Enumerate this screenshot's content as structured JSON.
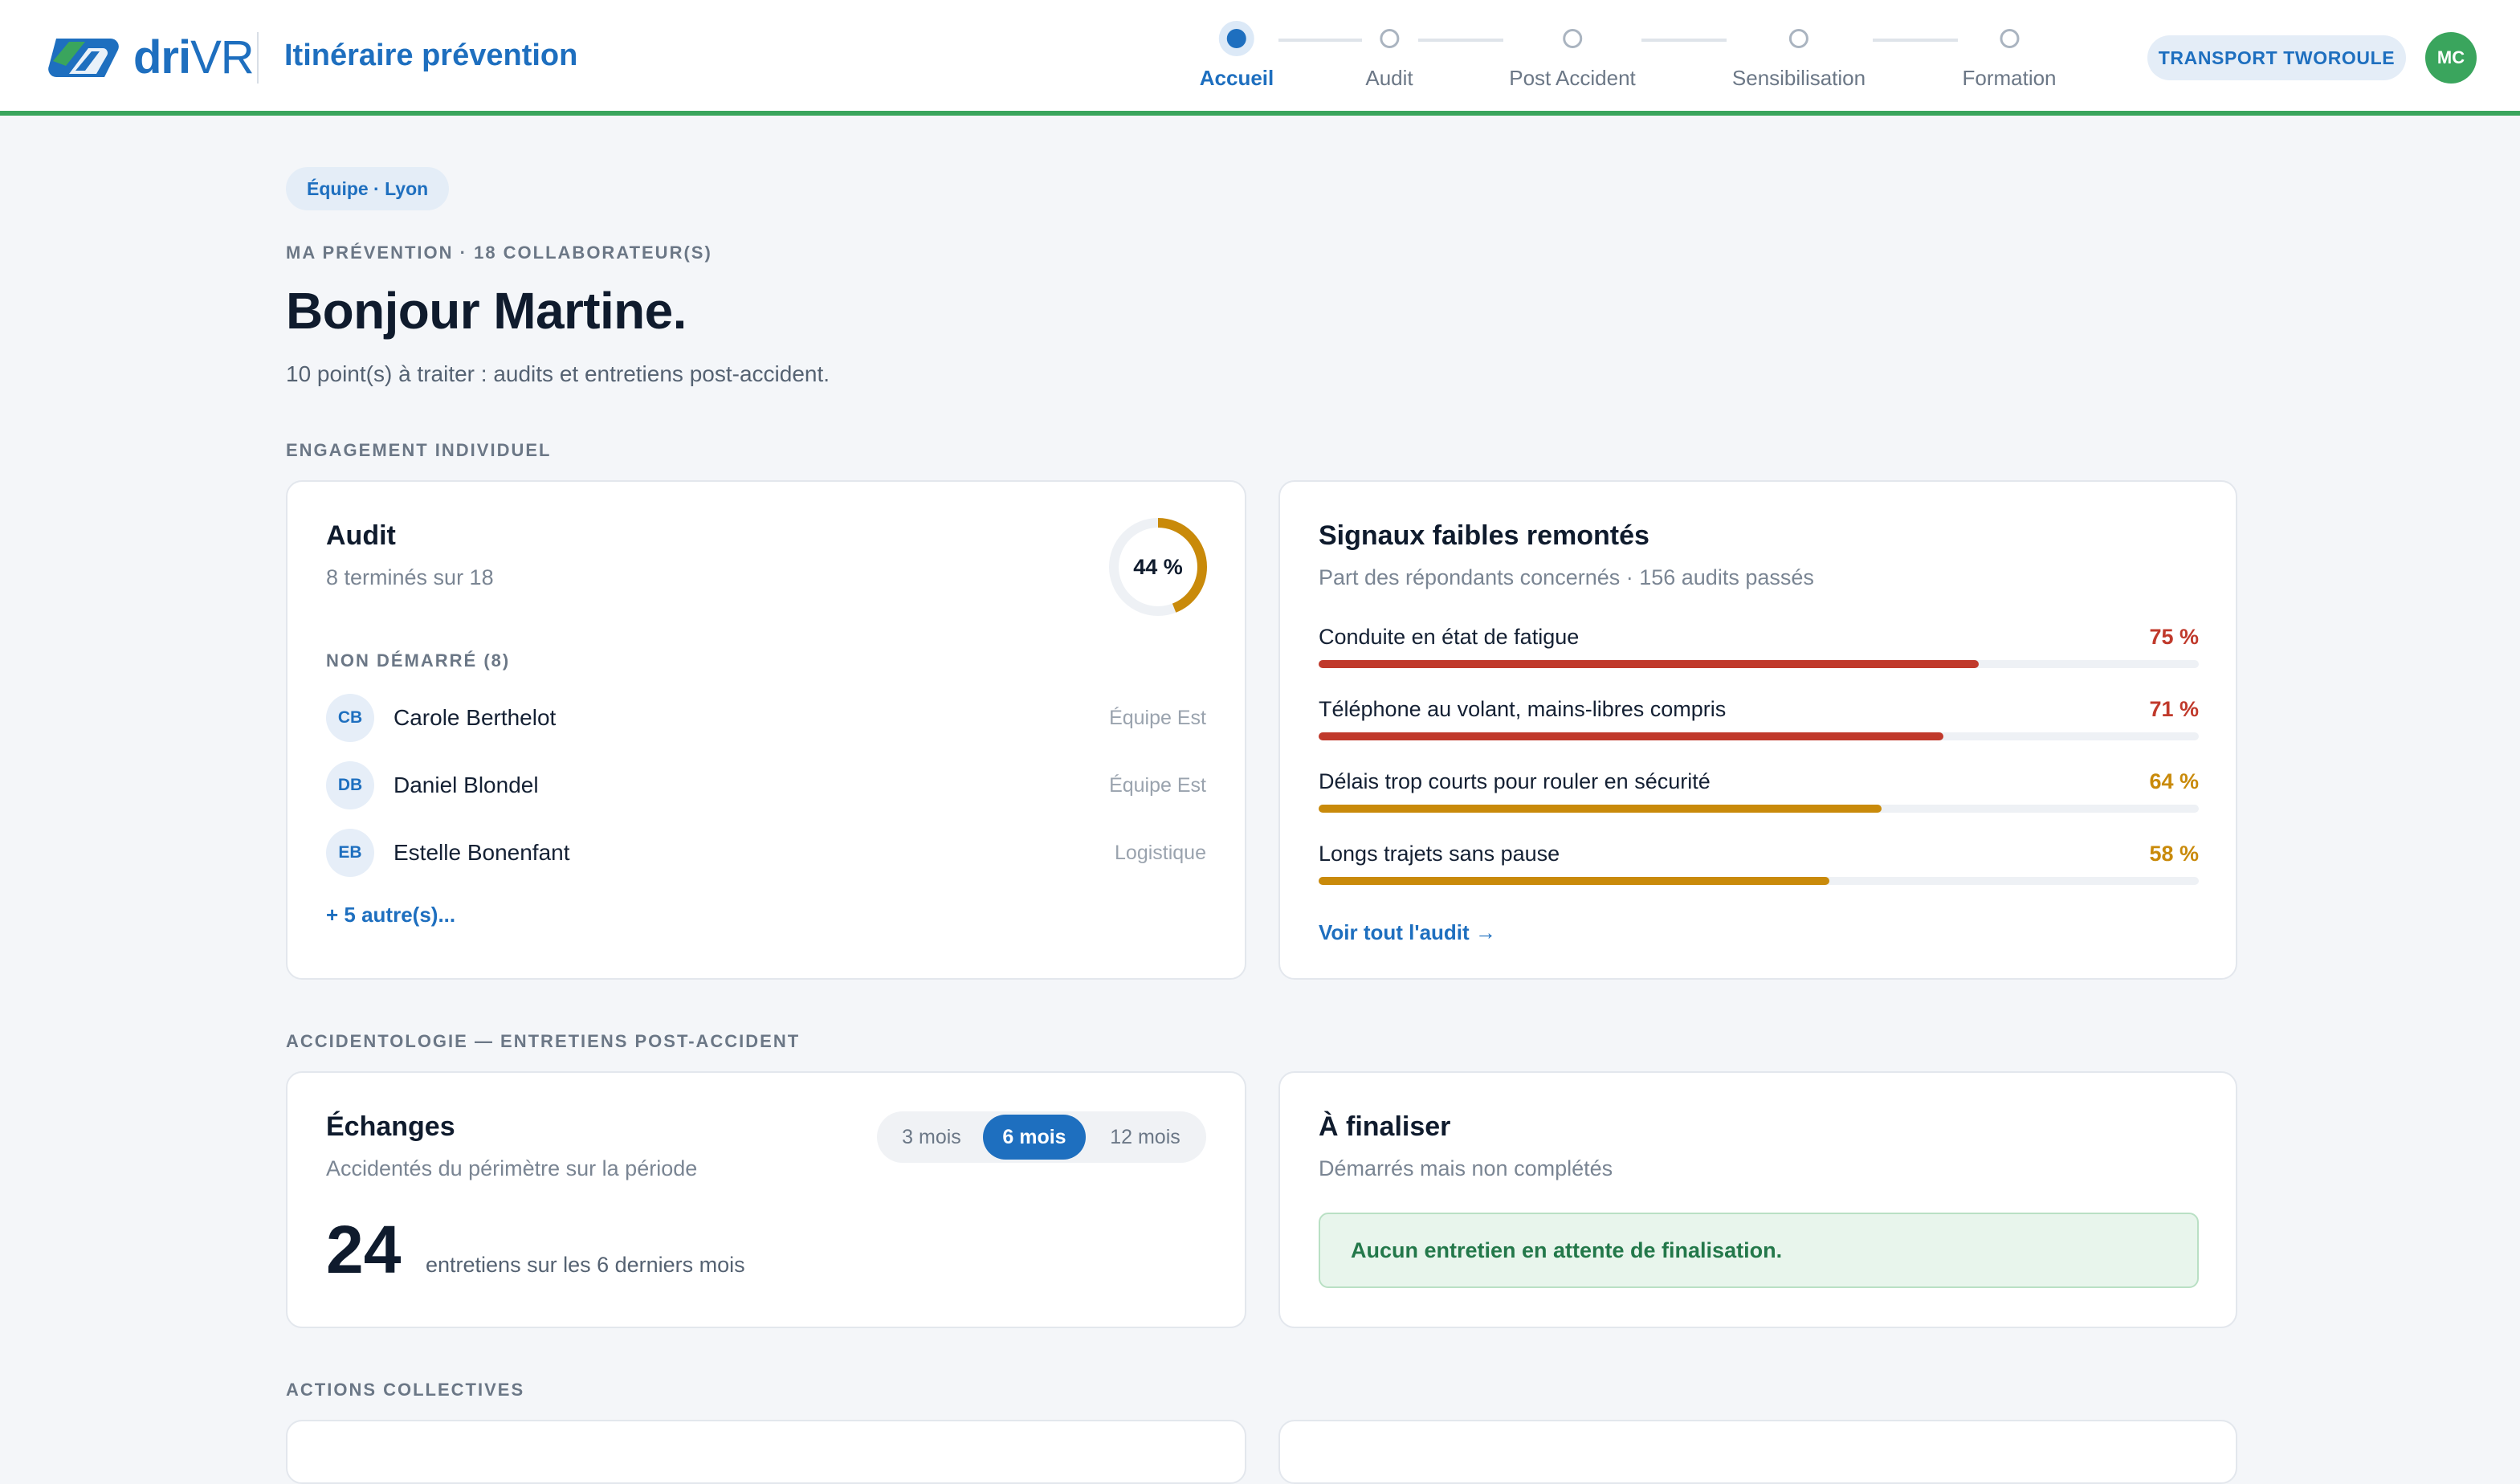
{
  "brand": {
    "logo_dri": "dri",
    "logo_vr": "VR",
    "app_title": "Itinéraire prévention"
  },
  "stepper": [
    {
      "label": "Accueil",
      "active": true
    },
    {
      "label": "Audit",
      "active": false
    },
    {
      "label": "Post Accident",
      "active": false
    },
    {
      "label": "Sensibilisation",
      "active": false
    },
    {
      "label": "Formation",
      "active": false
    }
  ],
  "company": "TRANSPORT TWOROULE",
  "user_initials": "MC",
  "team_chip": "Équipe · Lyon",
  "eyebrow": "MA PRÉVENTION · 18 COLLABORATEUR(S)",
  "greeting": "Bonjour Martine.",
  "subline": "10 point(s) à traiter : audits et entretiens post-accident.",
  "sections": {
    "engagement": "ENGAGEMENT INDIVIDUEL",
    "accidentologie": "ACCIDENTOLOGIE — ENTRETIENS POST-ACCIDENT",
    "actions": "ACTIONS COLLECTIVES"
  },
  "audit_card": {
    "title": "Audit",
    "subtitle": "8 terminés sur 18",
    "progress_label": "44 %",
    "progress": 0.44,
    "not_started_label": "NON DÉMARRÉ (8)",
    "people": [
      {
        "initials": "CB",
        "name": "Carole Berthelot",
        "team": "Équipe Est"
      },
      {
        "initials": "DB",
        "name": "Daniel Blondel",
        "team": "Équipe Est"
      },
      {
        "initials": "EB",
        "name": "Estelle Bonenfant",
        "team": "Logistique"
      }
    ],
    "more_link": "+ 5 autre(s)..."
  },
  "signals_card": {
    "title": "Signaux faibles remontés",
    "subtitle": "Part des répondants concernés · 156 audits passés",
    "items": [
      {
        "label": "Conduite en état de fatigue",
        "pct_label": "75 %",
        "value": 75,
        "color": "#c0392b"
      },
      {
        "label": "Téléphone au volant, mains-libres compris",
        "pct_label": "71 %",
        "value": 71,
        "color": "#c0392b"
      },
      {
        "label": "Délais trop courts pour rouler en sécurité",
        "pct_label": "64 %",
        "value": 64,
        "color": "#c98a0a"
      },
      {
        "label": "Longs trajets sans pause",
        "pct_label": "58 %",
        "value": 58,
        "color": "#c98a0a"
      }
    ],
    "see_all": "Voir tout l'audit →"
  },
  "exchanges_card": {
    "title": "Échanges",
    "subtitle": "Accidentés du périmètre sur la période",
    "periods": [
      "3 mois",
      "6 mois",
      "12 mois"
    ],
    "selected_period": "6 mois",
    "count": "24",
    "count_caption": "entretiens sur les 6 derniers mois"
  },
  "finalize_card": {
    "title": "À finaliser",
    "subtitle": "Démarrés mais non complétés",
    "empty_message": "Aucun entretien en attente de finalisation."
  },
  "colors": {
    "accent": "#1e6fbf",
    "success": "#3aa55d",
    "warning": "#c98a0a",
    "danger": "#c0392b"
  }
}
